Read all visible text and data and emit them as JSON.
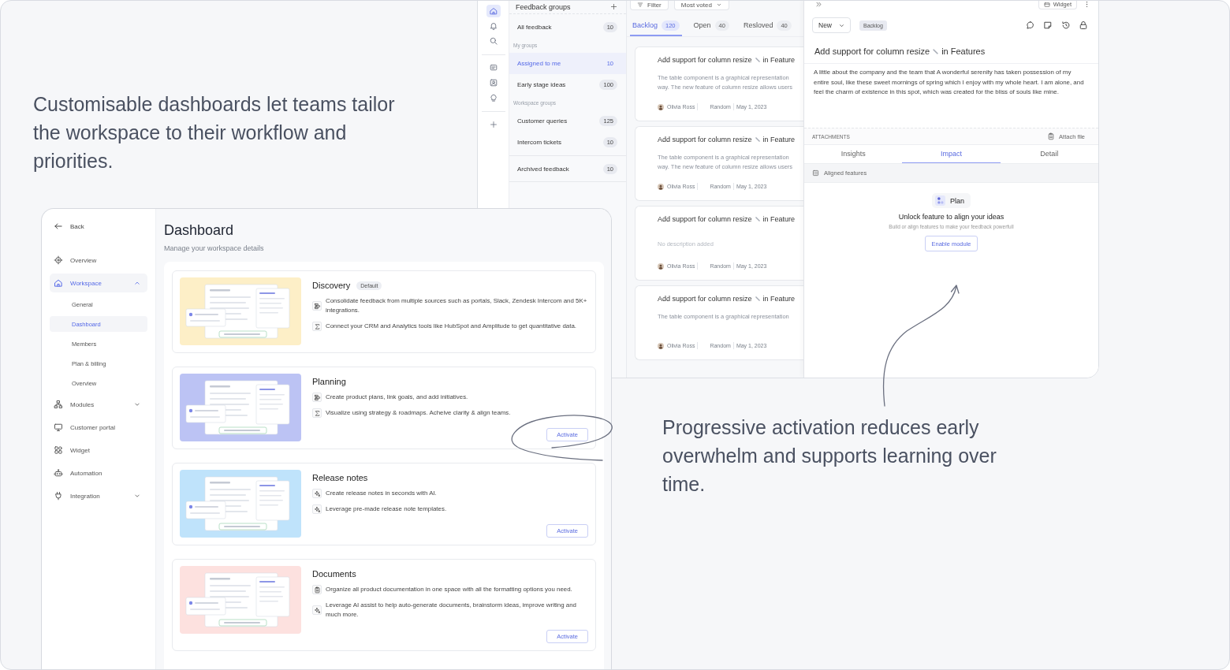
{
  "captions": [
    {
      "text": "Customisable dashboards let teams tailor the workspace to their workflow and priorities."
    },
    {
      "text": "Progressive activation reduces early overwhelm and supports learning over time."
    }
  ],
  "feedback_app": {
    "rail": [
      {
        "selected": true
      },
      {
        "selected": false
      },
      {
        "selected": false
      },
      {
        "selected": false
      },
      {
        "selected": false
      },
      {
        "selected": false
      }
    ],
    "groups_title": "Feedback groups",
    "group_sections": [
      {
        "items": [
          {
            "label": "All feedback",
            "count": "10",
            "selected": false
          }
        ]
      },
      {
        "heading": "My groups",
        "items": [
          {
            "label": "Assigned to me",
            "count": "10",
            "selected": true
          },
          {
            "label": "Early stage ideas",
            "count": "100",
            "selected": false
          }
        ]
      },
      {
        "heading": "Workspace groups",
        "items": [
          {
            "label": "Customer queries",
            "count": "125",
            "selected": false
          },
          {
            "label": "Intercom tickets",
            "count": "10",
            "selected": false
          }
        ]
      }
    ],
    "archived_group": {
      "label": "Archived feedback",
      "count": "10",
      "selected": false
    },
    "filter_button": "Filter",
    "sort_dropdown": "Most voted",
    "tabs": [
      {
        "label": "Backlog",
        "count": "120",
        "selected": true
      },
      {
        "label": "Open",
        "count": "40",
        "selected": false
      },
      {
        "label": "Resloved",
        "count": "40",
        "selected": false
      }
    ],
    "cards": [
      {
        "kind": "described",
        "title_start": "Add support for column resize",
        "title_end": "in Feature",
        "description": "The table component is a graphical representation way. The new feature of column resize allows users",
        "author": "Olivia Ross",
        "category": "Random",
        "date": "May 1, 2023"
      },
      {
        "kind": "described",
        "title_start": "Add support for column resize",
        "title_end": "in Feature",
        "description": "The table component is a graphical representation way. The new feature of column resize allows users",
        "author": "Olivia Ross",
        "category": "Random",
        "date": "May 1, 2023"
      },
      {
        "kind": "empty",
        "title_start": "Add support for column resize",
        "title_end": "in Feature",
        "description": "No description added",
        "author": "Olivia Ross",
        "category": "Random",
        "date": "May 1, 2023"
      },
      {
        "kind": "described",
        "title_start": "Add support for column resize",
        "title_end": "in Feature",
        "description": "The table component is a graphical representation",
        "author": "Olivia Ross",
        "category": "Random",
        "date": "May 1, 2023"
      }
    ]
  },
  "detail": {
    "widget_button": "Widget",
    "status": "New",
    "stage": "Backlog",
    "title_start": "Add support for column resize",
    "title_end": "in Features",
    "body": "A little about the company and the team that A wonderful serenity has taken possession of my entire soul, like these sweet mornings of spring which I enjoy with my whole heart. I am alone, and feel the charm of existence in this spot, which was created for the bliss of souls like mine.",
    "attachments_label": "ATTACHMENTS",
    "attach_action": "Attach file",
    "tabs": [
      {
        "label": "Insights",
        "selected": false
      },
      {
        "label": "Impact",
        "selected": true
      },
      {
        "label": "Detail",
        "selected": false
      }
    ],
    "section": "Aligned features",
    "plan_chip": "Plan",
    "unlock_title": "Unlock feature to align your ideas",
    "unlock_hint": "Build or align features to make your feedback powerfull",
    "enable_button": "Enable module"
  },
  "dashboard": {
    "back": "Back",
    "nav": [
      {
        "label": "Overview",
        "kind": "link",
        "selected": false
      },
      {
        "label": "Workspace",
        "kind": "group",
        "selected": true,
        "expanded": true,
        "children": [
          {
            "label": "General",
            "selected": false
          },
          {
            "label": "Dashboard",
            "selected": true
          },
          {
            "label": "Members",
            "selected": false
          },
          {
            "label": "Plan & billing",
            "selected": false
          },
          {
            "label": "Overview",
            "selected": false
          }
        ]
      },
      {
        "label": "Modules",
        "kind": "group",
        "selected": false,
        "expanded": false
      },
      {
        "label": "Customer portal",
        "kind": "link",
        "selected": false
      },
      {
        "label": "Widget",
        "kind": "link",
        "selected": false
      },
      {
        "label": "Automation",
        "kind": "link",
        "selected": false
      },
      {
        "label": "Integration",
        "kind": "group",
        "selected": false,
        "expanded": false
      }
    ],
    "title": "Dashboard",
    "subtitle": "Manage your workspace details",
    "modules": [
      {
        "title": "Discovery",
        "badge": "Default",
        "color": "#fdefc7",
        "features": [
          {
            "kind": "integration",
            "text": "Consolidate feedback from multiple sources such as portals, Slack, Zendesk Intercom and 5K+ integrations."
          },
          {
            "kind": "analytics",
            "text": "Connect your CRM and Analytics tools like HubSpot and Amplitude to get quantitative data."
          }
        ]
      },
      {
        "title": "Planning",
        "color": "#bcc3f4",
        "features": [
          {
            "kind": "integration",
            "text": "Create product plans, link goals, and add initiatives."
          },
          {
            "kind": "analytics",
            "text": "Visualize using strategy & roadmaps. Acheive clarity & align teams."
          }
        ],
        "action": "Activate"
      },
      {
        "title": "Release notes",
        "color": "#bfe3fb",
        "features": [
          {
            "kind": "ai",
            "text": "Create release notes in seconds with AI."
          },
          {
            "kind": "ai",
            "text": "Leverage pre-made release note templates."
          }
        ],
        "action": "Activate"
      },
      {
        "title": "Documents",
        "color": "#fde1df",
        "features": [
          {
            "kind": "document",
            "text": "Organize all product documentation in one space with all the formatting options you need."
          },
          {
            "kind": "ai",
            "text": "Leverage AI assist to help auto-generate documents, brainstorm ideas, improve writing and much more."
          }
        ],
        "action": "Activate"
      }
    ]
  }
}
